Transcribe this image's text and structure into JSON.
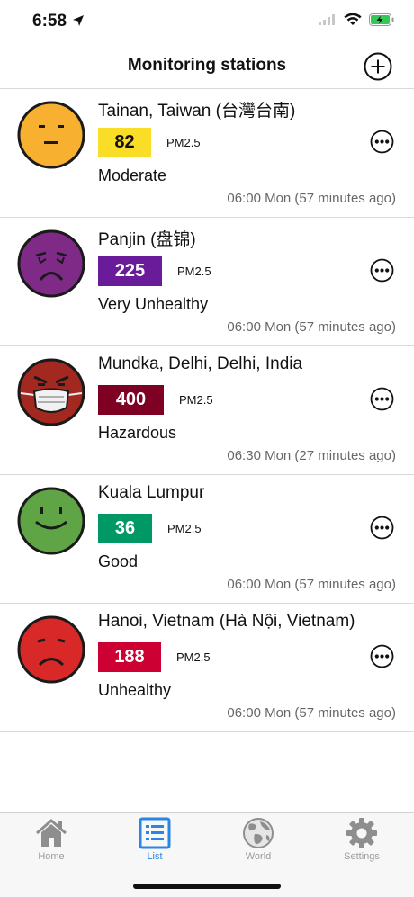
{
  "status": {
    "time": "6:58"
  },
  "nav": {
    "title": "Monitoring stations"
  },
  "stations": [
    {
      "name": "Tainan, Taiwan (台灣台南)",
      "aqi": "82",
      "pollutant": "PM2.5",
      "level": "Moderate",
      "updated": "06:00 Mon (57 minutes ago)",
      "badge_color": "#f9dd26",
      "text_color": "#111111",
      "face": "neutral",
      "face_color": "#f7b02f"
    },
    {
      "name": "Panjin (盘锦)",
      "aqi": "225",
      "pollutant": "PM2.5",
      "level": "Very Unhealthy",
      "updated": "06:00 Mon (57 minutes ago)",
      "badge_color": "#6a1b9a",
      "text_color": "#ffffff",
      "face": "very-unhealthy",
      "face_color": "#7f2a86"
    },
    {
      "name": "Mundka, Delhi, Delhi, India",
      "aqi": "400",
      "pollutant": "PM2.5",
      "level": "Hazardous",
      "updated": "06:30 Mon (27 minutes ago)",
      "badge_color": "#7e0023",
      "text_color": "#ffffff",
      "face": "hazardous",
      "face_color": "#a3281f"
    },
    {
      "name": "Kuala Lumpur",
      "aqi": "36",
      "pollutant": "PM2.5",
      "level": "Good",
      "updated": "06:00 Mon (57 minutes ago)",
      "badge_color": "#009966",
      "text_color": "#ffffff",
      "face": "good",
      "face_color": "#5fa545"
    },
    {
      "name": "Hanoi, Vietnam (Hà Nội, Vietnam)",
      "aqi": "188",
      "pollutant": "PM2.5",
      "level": "Unhealthy",
      "updated": "06:00 Mon (57 minutes ago)",
      "badge_color": "#cc0033",
      "text_color": "#ffffff",
      "face": "unhealthy",
      "face_color": "#d92828"
    }
  ],
  "tabs": [
    {
      "label": "Home",
      "icon": "house-icon",
      "active": false
    },
    {
      "label": "List",
      "icon": "list-icon",
      "active": true
    },
    {
      "label": "World",
      "icon": "globe-icon",
      "active": false
    },
    {
      "label": "Settings",
      "icon": "gear-icon",
      "active": false
    }
  ],
  "colors": {
    "accent": "#2a86e0",
    "inactive": "#9a9a9a"
  }
}
